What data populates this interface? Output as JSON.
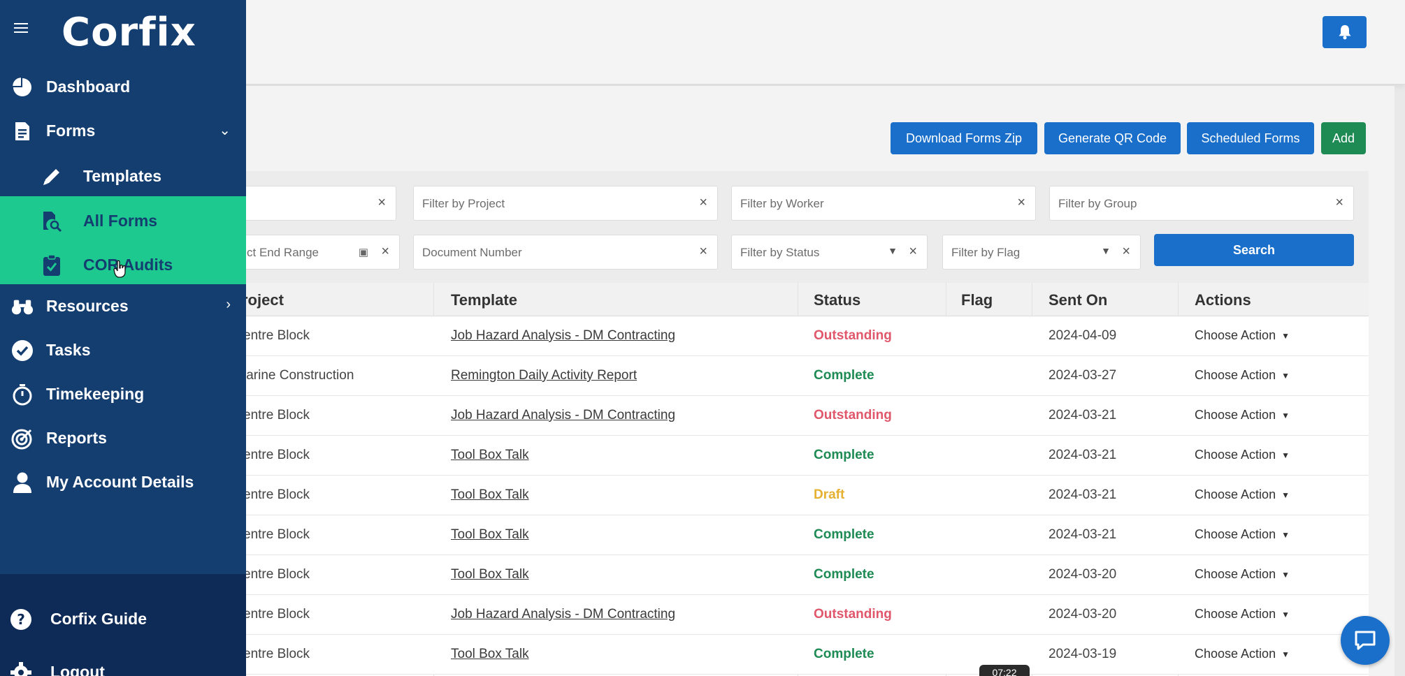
{
  "app": {
    "logo_text": "Corfix"
  },
  "sidebar": {
    "items": [
      {
        "label": "Dashboard",
        "icon": "pie-chart-icon"
      },
      {
        "label": "Forms",
        "icon": "document-icon",
        "chevron": "⌄"
      },
      {
        "label": "Templates",
        "icon": "pencil-icon"
      },
      {
        "label": "All Forms",
        "icon": "document-search-icon"
      },
      {
        "label": "COR Audits",
        "icon": "clipboard-check-icon"
      },
      {
        "label": "Resources",
        "icon": "binoculars-icon",
        "chevron": "›"
      },
      {
        "label": "Tasks",
        "icon": "check-circle-icon"
      },
      {
        "label": "Timekeeping",
        "icon": "stopwatch-icon"
      },
      {
        "label": "Reports",
        "icon": "target-icon"
      },
      {
        "label": "My Account Details",
        "icon": "user-icon"
      }
    ],
    "bottom": [
      {
        "label": "Corfix Guide",
        "icon": "question-circle-icon"
      },
      {
        "label": "Logout",
        "icon": "gear-icon"
      }
    ]
  },
  "toolbar": {
    "download_zip": "Download Forms Zip",
    "generate_qr": "Generate QR Code",
    "scheduled": "Scheduled Forms",
    "add": "Add"
  },
  "filters": {
    "first_row": [
      "",
      "Filter by Project",
      "Filter by Worker",
      "Filter by Group"
    ],
    "end_range": "ct End Range",
    "document_number": "Document Number",
    "status": "Filter by Status",
    "flag": "Filter by Flag",
    "search": "Search"
  },
  "table": {
    "headers": [
      "roject",
      "Template",
      "Status",
      "Flag",
      "Sent On",
      "Actions"
    ],
    "rows": [
      {
        "project": "entre Block",
        "template": "Job Hazard Analysis - DM Contracting",
        "status": "Outstanding",
        "sent": "2024-04-09",
        "action": "Choose Action"
      },
      {
        "project": "larine Construction",
        "template": "Remington Daily Activity Report",
        "status": "Complete",
        "sent": "2024-03-27",
        "action": "Choose Action"
      },
      {
        "project": "entre Block",
        "template": "Job Hazard Analysis - DM Contracting",
        "status": "Outstanding",
        "sent": "2024-03-21",
        "action": "Choose Action"
      },
      {
        "project": "entre Block",
        "template": "Tool Box Talk",
        "status": "Complete",
        "sent": "2024-03-21",
        "action": "Choose Action"
      },
      {
        "project": "entre Block",
        "template": "Tool Box Talk",
        "status": "Draft",
        "sent": "2024-03-21",
        "action": "Choose Action"
      },
      {
        "project": "entre Block",
        "template": "Tool Box Talk",
        "status": "Complete",
        "sent": "2024-03-21",
        "action": "Choose Action"
      },
      {
        "project": "entre Block",
        "template": "Tool Box Talk",
        "status": "Complete",
        "sent": "2024-03-20",
        "action": "Choose Action"
      },
      {
        "project": "entre Block",
        "template": "Job Hazard Analysis - DM Contracting",
        "status": "Outstanding",
        "sent": "2024-03-20",
        "action": "Choose Action"
      },
      {
        "project": "entre Block",
        "template": "Tool Box Talk",
        "status": "Complete",
        "sent": "2024-03-19",
        "action": "Choose Action"
      }
    ]
  },
  "status_colors": {
    "Outstanding": "#e0566a",
    "Complete": "#1e8a54",
    "Draft": "#e6b030"
  },
  "video_time": "07:22",
  "colors": {
    "sidebar": "#143d70",
    "active": "#1ec98f",
    "primary": "#1a6fca",
    "add": "#1e8a54"
  }
}
